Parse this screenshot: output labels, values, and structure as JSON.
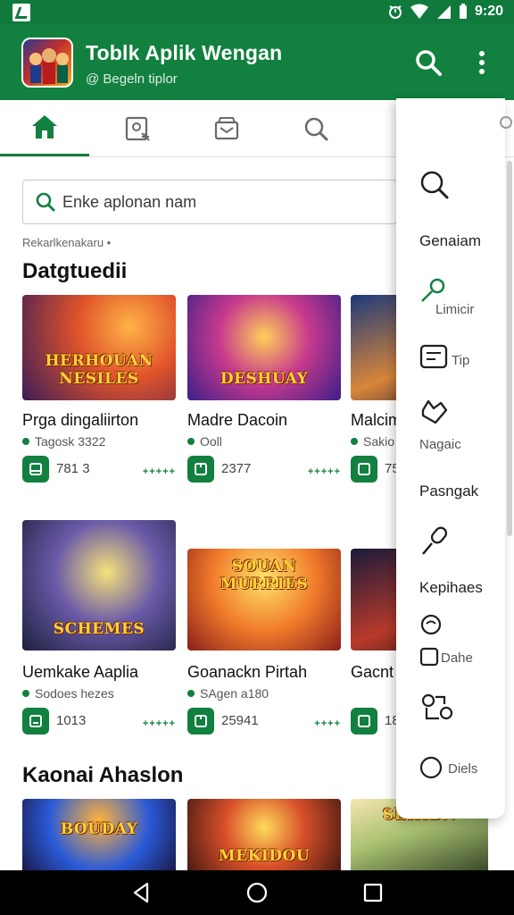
{
  "status": {
    "time": "9:20"
  },
  "app": {
    "title": "Toblk Aplik Wengan",
    "subtitle": "@ Begeln tiplor"
  },
  "search": {
    "placeholder": "Enke aplonan nam"
  },
  "caption": "Rekarlkenakaru •",
  "sections": [
    {
      "title": "Datgtuedii",
      "apps": [
        {
          "name": "Prga dingaliirton",
          "developer": "Tagosk 3322",
          "count": "781 3",
          "rating": "+++++",
          "art": "HERHOUAN NESILES"
        },
        {
          "name": "Madre Dacoin",
          "developer": "Ooll",
          "count": "2377",
          "rating": "+++++",
          "art": "DESHUAY"
        },
        {
          "name": "Malcim",
          "developer": "Sakio",
          "count": "75",
          "rating": "",
          "art": ""
        }
      ]
    },
    {
      "title": "",
      "apps": [
        {
          "name": "Uemkake Aaplia",
          "developer": "Sodoes hezes",
          "count": "1013",
          "rating": "+++++",
          "art": "SCHEMES"
        },
        {
          "name": "Goanackn Pirtah",
          "developer": "SAgen a180",
          "count": "25941",
          "rating": "++++",
          "art": "SOUAN MURRIES"
        },
        {
          "name": "Gacnt",
          "developer": "",
          "count": "18",
          "rating": "",
          "art": ""
        }
      ]
    },
    {
      "title": "Kaonai Ahaslon",
      "apps": [
        {
          "art": "BOUDAY"
        },
        {
          "art": "MEKIDOU"
        },
        {
          "art": "SEHIBN"
        }
      ]
    }
  ],
  "menu": {
    "items": [
      {
        "label": "Genaiam",
        "icon": "search-icon"
      },
      {
        "label": "Limicir",
        "icon": "pen-icon"
      },
      {
        "label": "Tip",
        "icon": "list-icon"
      },
      {
        "label": "Nagaic",
        "icon": "heart-hand-icon"
      },
      {
        "label": "Pasngak",
        "icon": ""
      },
      {
        "label": "Kepihaes",
        "icon": "microphone-icon"
      },
      {
        "label": "",
        "icon": "smile-icon"
      },
      {
        "label": "Dahe",
        "icon": "checkbox-icon"
      },
      {
        "label": "",
        "icon": "share-icon"
      },
      {
        "label": "Diels",
        "icon": "circle-icon"
      }
    ]
  },
  "colors": {
    "primary": "#12803f",
    "accent": "#0f7a3c"
  }
}
